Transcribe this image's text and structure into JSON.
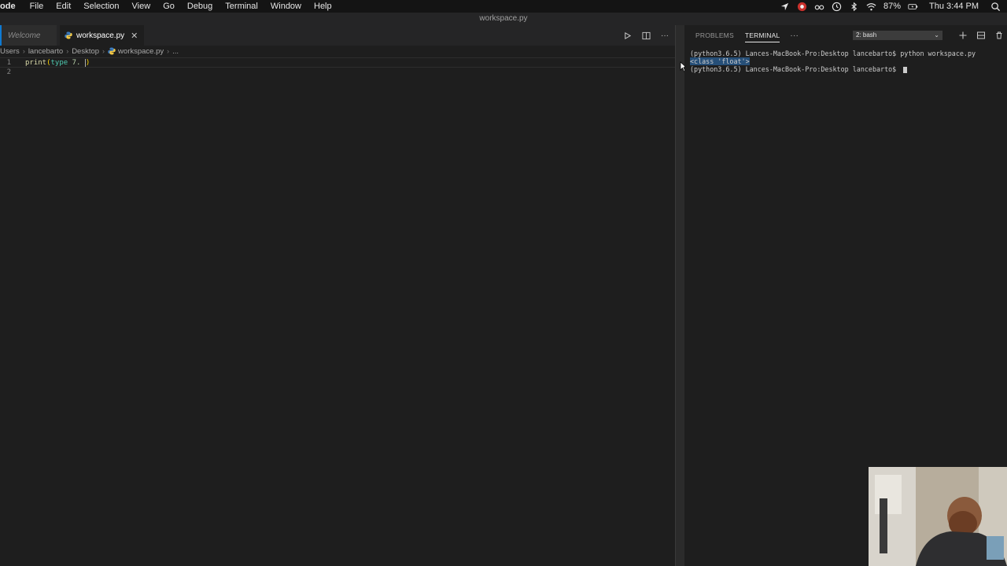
{
  "menubar": {
    "app": "ode",
    "items": [
      "File",
      "Edit",
      "Selection",
      "View",
      "Go",
      "Debug",
      "Terminal",
      "Window",
      "Help"
    ],
    "status": {
      "icons": [
        "location-arrow-icon",
        "record-icon",
        "glasses-icon",
        "time-machine-icon",
        "bluetooth-icon",
        "wifi-icon",
        "battery-icon",
        "spotlight-search-icon"
      ],
      "battery_pct": "87%",
      "clock": "Thu 3:44 PM"
    }
  },
  "window": {
    "title": "workspace.py"
  },
  "editor": {
    "tabs": [
      {
        "label": "Welcome",
        "active": false
      },
      {
        "label": "workspace.py",
        "active": true
      }
    ],
    "breadcrumb": [
      "Users",
      "lancebarto",
      "Desktop",
      "workspace.py",
      "..."
    ],
    "lines": [
      {
        "number": "1",
        "tokens": {
          "fn": "print",
          "open": "(",
          "builtin": "type",
          "space": " ",
          "num": "7.",
          "space2": " ",
          "close": ")"
        }
      },
      {
        "number": "2",
        "text": ""
      }
    ]
  },
  "panel": {
    "tabs": [
      "PROBLEMS",
      "TERMINAL"
    ],
    "active_tab": "TERMINAL",
    "more": "···",
    "terminal_select": "2: bash",
    "lines": [
      "(python3.6.5) Lances-MacBook-Pro:Desktop lancebarto$ python workspace.py",
      "<class 'float'>",
      "(python3.6.5) Lances-MacBook-Pro:Desktop lancebarto$ "
    ]
  },
  "colors": {
    "background": "#1e1e1e",
    "tabbar": "#252526",
    "accent": "#0e7ad3",
    "selection": "#264f78"
  }
}
